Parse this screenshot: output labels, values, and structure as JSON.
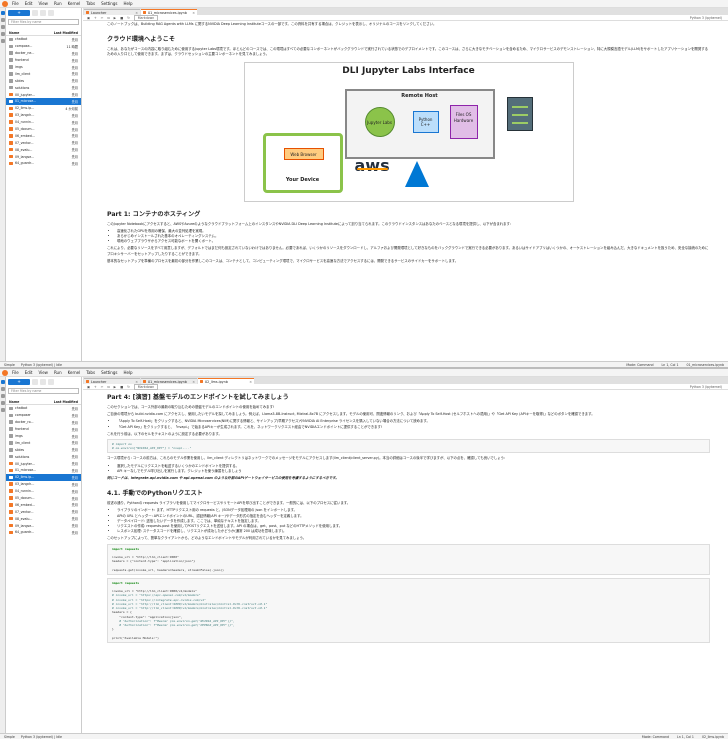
{
  "menu": [
    "File",
    "Edit",
    "View",
    "Run",
    "Kernel",
    "Tabs",
    "Settings",
    "Help"
  ],
  "filebrowser": {
    "new_label": "+",
    "filter_placeholder": "Filter files by name",
    "col_name": "Name",
    "col_modified": "Last Modified"
  },
  "win1": {
    "tabs": [
      {
        "label": "Launcher"
      },
      {
        "label": "01_microservices.ipynb"
      }
    ],
    "files": [
      {
        "name": "chatbot",
        "mod": "先月",
        "type": "folder"
      },
      {
        "name": "compose...",
        "mod": "11 時間",
        "type": "folder"
      },
      {
        "name": "docker_ne...",
        "mod": "先月",
        "type": "folder"
      },
      {
        "name": "frontend",
        "mod": "先月",
        "type": "folder"
      },
      {
        "name": "imgs",
        "mod": "先月",
        "type": "folder"
      },
      {
        "name": "llm_client",
        "mod": "先月",
        "type": "folder"
      },
      {
        "name": "slides",
        "mod": "先月",
        "type": "folder"
      },
      {
        "name": "solutions",
        "mod": "先月",
        "type": "folder"
      },
      {
        "name": "00_jupyter...",
        "mod": "先月",
        "type": "nb"
      },
      {
        "name": "01_microse...",
        "mod": "先月",
        "type": "nb",
        "selected": true
      },
      {
        "name": "02_llms.ip...",
        "mod": "4 か月前",
        "type": "nb"
      },
      {
        "name": "03_langch...",
        "mod": "先月",
        "type": "nb"
      },
      {
        "name": "04_runnin...",
        "mod": "先月",
        "type": "nb"
      },
      {
        "name": "05_docum...",
        "mod": "先月",
        "type": "nb"
      },
      {
        "name": "06_embed...",
        "mod": "先月",
        "type": "nb"
      },
      {
        "name": "07_vector...",
        "mod": "先月",
        "type": "nb"
      },
      {
        "name": "08_evalu...",
        "mod": "先月",
        "type": "nb"
      },
      {
        "name": "09_langse...",
        "mod": "先月",
        "type": "nb"
      },
      {
        "name": "64_guardr...",
        "mod": "先月",
        "type": "nb"
      }
    ],
    "toolbar_mode": "Markdown",
    "kernel": "Python 3 (ipykernel)",
    "intro": "このノートブックは、Building RAG Agents with LLMs に関するNVIDIA Deep Learning Instituteコースの一部です。この資料を共有する場合は、クレジットを表示し、オリジナルのコースをリンクしてください。",
    "h_welcome": "クラウド環境へようこそ",
    "p_welcome": "これは、あなたがコースの内容に取り組むために使用するJupyter Labs環境です。ほとんどのコースでは、この環境はすべての必要なコンポーネントがバックグラウンドで実行されている状態でのデプロイメントです。このコースは、さらに大きなモチベーションを含めるため、マイクロサービスのデモンストレーション、特に大規模言語モデル(LLM)をサポートしたアプリケーションを開発するための入り口として使用できます。まずは、クラウドセッションの主要コンポーネントを見てみましょう。",
    "diagram": {
      "title": "DLI Jupyter Labs Interface",
      "remote": "Remote Host",
      "device": "Your Device",
      "browser": "Web Browser",
      "jupyter": "Jupyter Labs",
      "python": "Python C++",
      "files": "Files OS Hardware",
      "aws": "aws"
    },
    "h_part1_prefix": "Part 1:",
    "h_part1": " コンテナのホスティング",
    "p_part1": "このJupyter Notebookにアクセスすると、AWSやAzureのようなクラウドプラットフォーム上のインスタンスやNVIDIA DLI Deep Learning Instituteによって割り当てられます。このクラウドインスタンスはあなたのベースとなる環境を提供し、以下が含まれます:",
    "part1_list": [
      "高速化されたGPUを専用の確保、最大の並列処理を実現。",
      "あらかじめインストールされた基本のオペレーティングシステム。",
      "現地のウェブブラウザからアクセス可能なポートを開くポート。"
    ],
    "p_part1b": "これにより、必要なリソースをすべて用意しますが、デフォルトではまだ何も設定されていないわけではありません。必要であれば、いくつかのリソースをダウンロードし、アルファおよび開発環境として好きなものをバックグラウンドで実行できる必要があります。あるいはサイドアプリはいくつかの、オーケストレーションを組み込んだ、大きなドキュメントを扱うため、安全な接続のためにプロキシサーバーをセットアップしたりすることができます。",
    "p_part1c": "基本的なセットアップを準備のプロセスを最初の部分を作業しこのコースは、コンテナとして、コンピューティング環境で、マイクロサービスを高速な方法でアクセスするには、開発できるサービスのサイドカーをサポートします。",
    "status_left": "Simple",
    "status_mid": "Python 3 (ipykernel) | Idle",
    "status_mode": "Mode: Command",
    "status_pos": "Ln 1, Col 1",
    "status_file": "01_microservices.ipynb"
  },
  "win2": {
    "tabs": [
      {
        "label": "Launcher"
      },
      {
        "label": "01_microservices.ipynb"
      },
      {
        "label": "02_llms.ipynb"
      }
    ],
    "files": [
      {
        "name": "chatbot",
        "mod": "先月",
        "type": "folder"
      },
      {
        "name": "composer",
        "mod": "先月",
        "type": "folder"
      },
      {
        "name": "docker_ro...",
        "mod": "先月",
        "type": "folder"
      },
      {
        "name": "frontend",
        "mod": "先月",
        "type": "folder"
      },
      {
        "name": "imgs",
        "mod": "先月",
        "type": "folder"
      },
      {
        "name": "llm_client",
        "mod": "先月",
        "type": "folder"
      },
      {
        "name": "slides",
        "mod": "先月",
        "type": "folder"
      },
      {
        "name": "solutions",
        "mod": "先月",
        "type": "folder"
      },
      {
        "name": "00_jupyter...",
        "mod": "先月",
        "type": "nb"
      },
      {
        "name": "01_microse...",
        "mod": "先月",
        "type": "nb"
      },
      {
        "name": "02_llms.ip...",
        "mod": "先月",
        "type": "nb",
        "selected": true
      },
      {
        "name": "03_langch...",
        "mod": "先月",
        "type": "nb"
      },
      {
        "name": "04_runnin...",
        "mod": "先月",
        "type": "nb"
      },
      {
        "name": "05_docum...",
        "mod": "先月",
        "type": "nb"
      },
      {
        "name": "06_embed...",
        "mod": "先月",
        "type": "nb"
      },
      {
        "name": "07_vector...",
        "mod": "先月",
        "type": "nb"
      },
      {
        "name": "08_evalu...",
        "mod": "先月",
        "type": "nb"
      },
      {
        "name": "09_langse...",
        "mod": "先月",
        "type": "nb"
      },
      {
        "name": "64_guardr...",
        "mod": "先月",
        "type": "nb"
      }
    ],
    "toolbar_mode": "Markdown",
    "kernel": "Python 3 (ipykernel)",
    "h_part4_prefix": "Part 4:",
    "h_part4": " [演習] 基盤モデルのエンドポイントを試してみましょう",
    "p4a": "このセクションでは、コース外部の最新の取り込むための基盤モデルのエンドポイントの使用を始めてみます!",
    "p4b": "ご自身の環境から build.nvidia.com にアクセスし、使用したいモデルを探してみましょう。例えば、Llama3-8B-Instruct, Mixtral-8x7B にアクセスします。モデルの使用可、関連情報のリンク、および「Apply To Self-Host (セルフホストへの適用)」や「Get API Key (APIキーを取得)」などのボタンを確認できます。",
    "p4_list1": [
      "「Apply To Self-Host」をクリックすると、NVIDIA Microservices(NIM)に関する情報と、サインアップ(早期アクセス)やNVIDIA AI Enterprise ライセンスを購入していない場合の方法について読めます。",
      "「Get API Key」をクリックすると、「nvapi-」で始まるAPIキーが生成されます。これを、ネットワークリクエスト経由でNVIDIAエンドポイントに提供することができます!"
    ],
    "p4c": "これを行う前は、以下のセルをテキストのように設定する必要があります。",
    "code1_line1": "# import os",
    "code1_line2": "# os.environ[\"NVIDIA_API_KEY\"] = \"nvapi-...\"",
    "p4d": "コース環境から: コースの前方は、これらのモデル作業を使用し、llm_client ディレクトリはネットワークでのメッセージをモデルにアクセスします(llm_client/client_server.py)。本当の詳細はコースの後半で学びますが、以下の点を、確認しても良いでしょう:",
    "p4_list2": [
      "選択したモデルにリクエストを転送するいくつかのエンドポイントを提供する。",
      "API キーなしでモデル呼び出しを実行します。クレジットを使う練習をしましょう"
    ],
    "p4e": "同じコードは、integrate.api.nvidia.com や api.openai.com のような外部のAPIゲートウェイサービスの使用を考慮するようにするべきです。",
    "h_41": "4.1. 手動でのPythonリクエスト",
    "p41": "前述の通り、Pythonの requests ライブラリを使用してマイクロサービスやリモートAPIを呼び出すことができます。一般的には、以下のプロセスに従います。",
    "p41_list": [
      "ライブラリのインポート: まず、HTTPリクエスト用の requests と、JSONデータ処理用の json をインポートします。",
      "APIの URL とヘッダー: APIエンドポイントのURL、認証情報(API キー)やデータ形式の指定を含むヘッダーを定義します。",
      "データペイロード: 送信したいデータを作成します。ここでは、単純なテキストを指定します。",
      "リクエストの作成: requests.post を使用してPOSTリクエストを送信します。API の場合は、get、post、put などのHTTPメソッドを使用します。",
      "レスポンス処理: ステータスコードを確認し、リクエストが成功したかどうか(通常 200 は成功を意味します)。"
    ],
    "p41b": "このセットアップによって、簡単なクライアントから、どのようなエンドポイントやモデルが利用されているかを見てみましょう。",
    "code2": [
      "import requests",
      "",
      "invoke_url = \"http://llm_client:9000\"",
      "headers = {\"content-type\": \"application/json\"}",
      "",
      "requests.get(invoke_url, headers=headers, stream=False).json()"
    ],
    "code3": [
      "import requests",
      "",
      "invoke_url = \"http://llm_client:9000/v1/models\"",
      "# invoke_url = \"https://api.openai.com/v1/models\"",
      "# invoke_url = \"https://integrate.api.nvidia.com/v1\"",
      "# invoke_url = \"http://llm_client:9000/v1/models/mistralai/mixtral-8x7b-instruct-v0.1\"",
      "# invoke_url = \"http://llm_client:9000/v1/models/mistralai/mixtral-8x7b-instruct-v0.1\"",
      "headers = {",
      "    \"content-type\": \"application/json\",",
      "    # \"Authorization\": f\"Bearer {os.environ.get('NVIDIA_API_KEY')}\",",
      "    # \"Authorization\": f\"Bearer {os.environ.get('OPENAI_API_KEY')}\",",
      "}",
      "",
      "print(\"Available Models:\")"
    ],
    "status_left": "Simple",
    "status_mid": "Python 3 (ipykernel) | Idle",
    "status_mode": "Mode: Command",
    "status_pos": "Ln 1, Col 1",
    "status_file": "02_llms.ipynb"
  }
}
